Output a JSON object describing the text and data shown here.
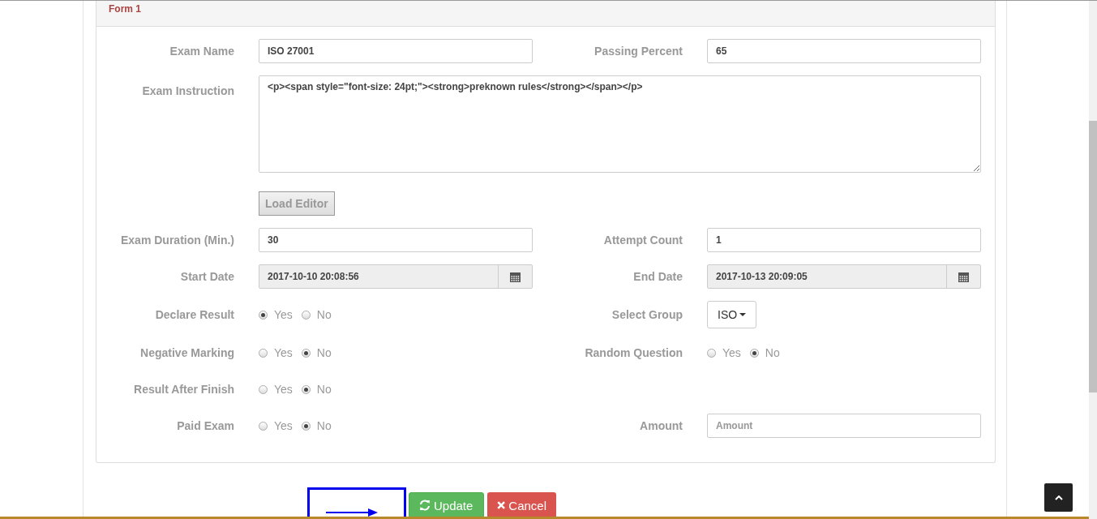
{
  "panel": {
    "title": "Form 1"
  },
  "rows": [
    {
      "fields": [
        {
          "kind": "text",
          "label": "Exam Name",
          "value": "ISO 27001"
        },
        {
          "kind": "text",
          "label": "Passing Percent",
          "value": "65"
        }
      ]
    },
    {
      "fields": [
        {
          "kind": "textarea",
          "label": "Exam Instruction",
          "value": "<p><span style=\"font-size: 24pt;\"><strong>preknown rules</strong></span></p>"
        }
      ]
    },
    {
      "fields": [
        {
          "kind": "button",
          "text": "Load Editor"
        }
      ]
    },
    {
      "fields": [
        {
          "kind": "text",
          "label": "Exam Duration (Min.)",
          "value": "30"
        },
        {
          "kind": "text",
          "label": "Attempt Count",
          "value": "1"
        }
      ]
    },
    {
      "fields": [
        {
          "kind": "date",
          "label": "Start Date",
          "value": "2017-10-10 20:08:56"
        },
        {
          "kind": "date",
          "label": "End Date",
          "value": "2017-10-13 20:09:05"
        }
      ]
    },
    {
      "fields": [
        {
          "kind": "radio",
          "label": "Declare Result",
          "options": [
            {
              "label": "Yes",
              "selected": true
            },
            {
              "label": "No",
              "selected": false
            }
          ]
        },
        {
          "kind": "dropdown",
          "label": "Select Group",
          "value": "ISO"
        }
      ]
    },
    {
      "fields": [
        {
          "kind": "radio",
          "label": "Negative Marking",
          "options": [
            {
              "label": "Yes",
              "selected": false
            },
            {
              "label": "No",
              "selected": true
            }
          ]
        },
        {
          "kind": "radio",
          "label": "Random Question",
          "options": [
            {
              "label": "Yes",
              "selected": false
            },
            {
              "label": "No",
              "selected": true
            }
          ]
        }
      ]
    },
    {
      "fields": [
        {
          "kind": "radio",
          "label": "Result After Finish",
          "options": [
            {
              "label": "Yes",
              "selected": false
            },
            {
              "label": "No",
              "selected": true
            }
          ]
        }
      ]
    },
    {
      "fields": [
        {
          "kind": "radio",
          "label": "Paid Exam",
          "options": [
            {
              "label": "Yes",
              "selected": false
            },
            {
              "label": "No",
              "selected": true
            }
          ]
        },
        {
          "kind": "text",
          "label": "Amount",
          "placeholder": "Amount"
        }
      ]
    }
  ],
  "actions": [
    {
      "kind": "update",
      "text": "Update"
    },
    {
      "kind": "cancel",
      "text": "Cancel"
    }
  ]
}
